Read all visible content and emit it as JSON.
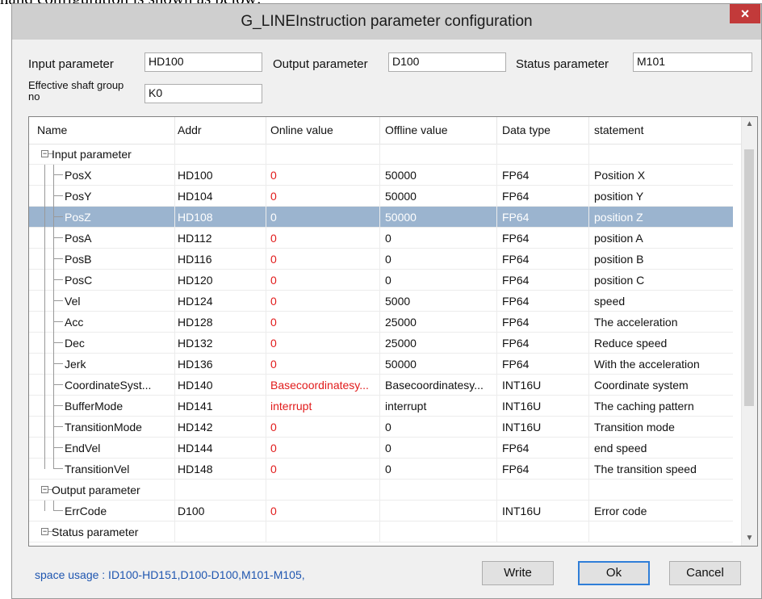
{
  "doc_text": "nand configuration is shown as below:",
  "window": {
    "title": "G_LINEInstruction parameter configuration",
    "close_glyph": "×"
  },
  "form": {
    "input_label": "Input parameter",
    "input_value": "HD100",
    "output_label": "Output parameter",
    "output_value": "D100",
    "status_label": "Status parameter",
    "status_value": "M101",
    "shaft_label": "Effective shaft group no",
    "shaft_value": "K0"
  },
  "grid": {
    "headers": [
      "Name",
      "Addr",
      "Online value",
      "Offline value",
      "Data type",
      "statement"
    ],
    "rows": [
      {
        "kind": "group",
        "name": "Input parameter",
        "addr": "",
        "online": "",
        "offline": "",
        "type": "",
        "statement": ""
      },
      {
        "kind": "child",
        "name": "PosX",
        "addr": "HD100",
        "online": "0",
        "offline": "50000",
        "type": "FP64",
        "statement": "Position X"
      },
      {
        "kind": "child",
        "name": "PosY",
        "addr": "HD104",
        "online": "0",
        "offline": "50000",
        "type": "FP64",
        "statement": "position Y"
      },
      {
        "kind": "child",
        "name": "PosZ",
        "addr": "HD108",
        "online": "0",
        "offline": "50000",
        "type": "FP64",
        "statement": "position Z",
        "selected": true
      },
      {
        "kind": "child",
        "name": "PosA",
        "addr": "HD112",
        "online": "0",
        "offline": "0",
        "type": "FP64",
        "statement": "position A"
      },
      {
        "kind": "child",
        "name": "PosB",
        "addr": "HD116",
        "online": "0",
        "offline": "0",
        "type": "FP64",
        "statement": "position B"
      },
      {
        "kind": "child",
        "name": "PosC",
        "addr": "HD120",
        "online": "0",
        "offline": "0",
        "type": "FP64",
        "statement": "position C"
      },
      {
        "kind": "child",
        "name": "Vel",
        "addr": "HD124",
        "online": "0",
        "offline": "5000",
        "type": "FP64",
        "statement": "speed"
      },
      {
        "kind": "child",
        "name": "Acc",
        "addr": "HD128",
        "online": "0",
        "offline": "25000",
        "type": "FP64",
        "statement": "The acceleration"
      },
      {
        "kind": "child",
        "name": "Dec",
        "addr": "HD132",
        "online": "0",
        "offline": "25000",
        "type": "FP64",
        "statement": "Reduce speed"
      },
      {
        "kind": "child",
        "name": "Jerk",
        "addr": "HD136",
        "online": "0",
        "offline": "50000",
        "type": "FP64",
        "statement": "With the acceleration"
      },
      {
        "kind": "child",
        "name": "CoordinateSyst...",
        "addr": "HD140",
        "online": "Basecoordinatesy...",
        "offline": "Basecoordinatesy...",
        "type": "INT16U",
        "statement": "Coordinate system"
      },
      {
        "kind": "child",
        "name": "BufferMode",
        "addr": "HD141",
        "online": "interrupt",
        "offline": "interrupt",
        "type": "INT16U",
        "statement": "The caching pattern"
      },
      {
        "kind": "child",
        "name": "TransitionMode",
        "addr": "HD142",
        "online": "0",
        "offline": "0",
        "type": "INT16U",
        "statement": "Transition mode"
      },
      {
        "kind": "child",
        "name": "EndVel",
        "addr": "HD144",
        "online": "0",
        "offline": "0",
        "type": "FP64",
        "statement": "end speed"
      },
      {
        "kind": "child",
        "name": "TransitionVel",
        "addr": "HD148",
        "online": "0",
        "offline": "0",
        "type": "FP64",
        "statement": "The transition speed",
        "last": true
      },
      {
        "kind": "group",
        "name": "Output parameter",
        "addr": "",
        "online": "",
        "offline": "",
        "type": "",
        "statement": ""
      },
      {
        "kind": "child",
        "name": "ErrCode",
        "addr": "D100",
        "online": "0",
        "offline": "",
        "type": "INT16U",
        "statement": "Error code",
        "last": true
      },
      {
        "kind": "group",
        "name": "Status parameter",
        "addr": "",
        "online": "",
        "offline": "",
        "type": "",
        "statement": ""
      }
    ]
  },
  "footer": {
    "usage": "space usage : ID100-HD151,D100-D100,M101-M105,",
    "write_label": "Write",
    "ok_label": "Ok",
    "cancel_label": "Cancel"
  },
  "colors": {
    "selection": "#9bb4cf",
    "online_value": "#e11b1b",
    "usage_text": "#1f56b0",
    "close": "#c23a3a"
  },
  "icons": {
    "close": "close-icon",
    "expand": "minus-box-icon",
    "scroll_up": "chevron-up-icon",
    "scroll_down": "chevron-down-icon"
  }
}
